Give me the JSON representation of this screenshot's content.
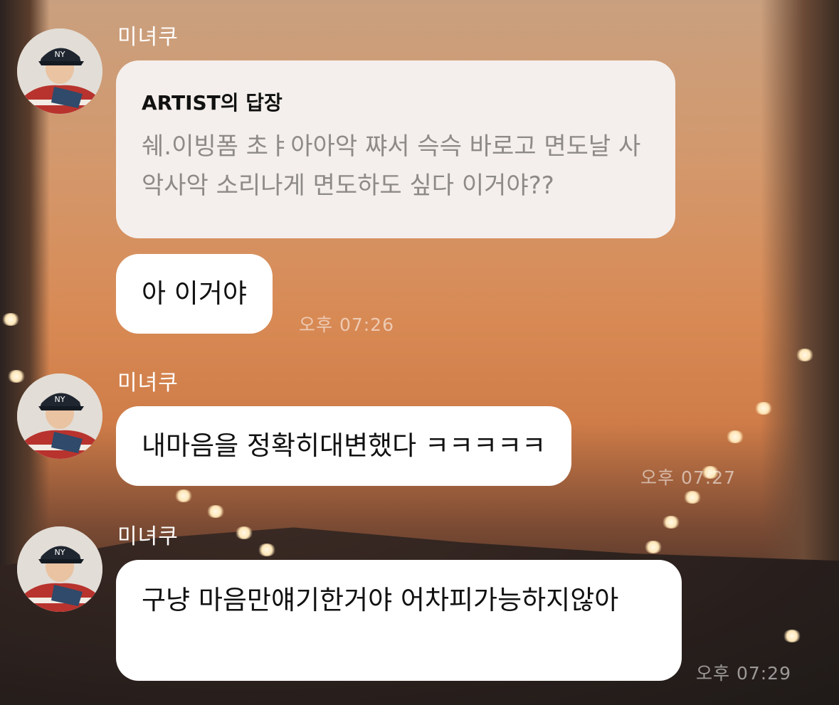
{
  "messages": [
    {
      "sender": "미녀쿠",
      "reply": {
        "title": "ARTIST의 답장",
        "body": "쉐.이빙폼 초ㅑ아아악 쨔서 슥슥 바로고 면도날 사악사악 소리나게 면도하도 싶다 이거야??"
      },
      "text": "아 이거야",
      "time": "오후 07:26"
    },
    {
      "sender": "미녀쿠",
      "text": "내마음을 정확히대변했다 ㅋㅋㅋㅋㅋ",
      "time": "오후 07:27"
    },
    {
      "sender": "미녀쿠",
      "text": "구냥 마음만얘기한거야 어차피가능하지않아",
      "time": "오후 07:29"
    }
  ],
  "avatar_icon": "user-photo-avatar",
  "colors": {
    "bubble": "#ffffff",
    "reply_bubble": "#f4efec",
    "reply_text": "#8d8a88",
    "name_text": "#ffffff"
  }
}
